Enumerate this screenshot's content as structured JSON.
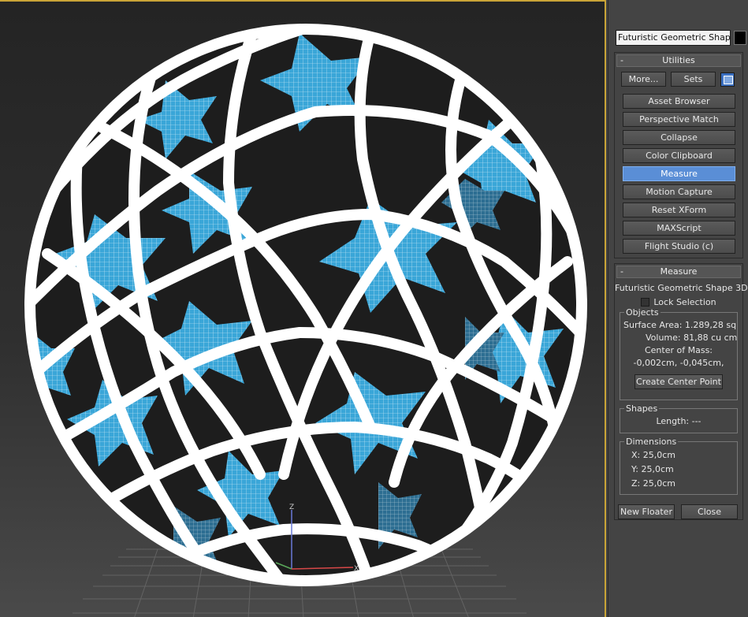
{
  "object_name": "Futuristic Geometric Shape 3D",
  "colors": {
    "viewport_border": "#c9a437",
    "active_button": "#5a8ed6",
    "mesh_blue": "#3aa6d8",
    "mesh_white": "#ffffff"
  },
  "utilities": {
    "header": "Utilities",
    "more_label": "More...",
    "sets_label": "Sets",
    "sets_icon": "configure-button-sets-icon",
    "items": [
      "Asset Browser",
      "Perspective Match",
      "Collapse",
      "Color Clipboard",
      "Measure",
      "Motion Capture",
      "Reset XForm",
      "MAXScript",
      "Flight Studio (c)"
    ],
    "active_item": "Measure"
  },
  "measure": {
    "header": "Measure",
    "object_name": "Futuristic Geometric Shape 3D",
    "lock_selection_label": "Lock Selection",
    "objects": {
      "label": "Objects",
      "surface_area": "Surface Area:  1.289,28 sq",
      "volume": "Volume:  81,88 cu cm",
      "center_of_mass_label": "Center of Mass:",
      "center_of_mass_value": "-0,002cm, -0,045cm,",
      "create_center_point_label": "Create Center Point"
    },
    "shapes": {
      "label": "Shapes",
      "length": "Length:  ---"
    },
    "dimensions": {
      "label": "Dimensions",
      "x": "X:   25,0cm",
      "y": "Y:   25,0cm",
      "z": "Z:   25,0cm"
    },
    "new_floater_label": "New Floater",
    "close_label": "Close"
  },
  "viewport": {
    "axis_x": "X",
    "axis_z": "Z"
  }
}
